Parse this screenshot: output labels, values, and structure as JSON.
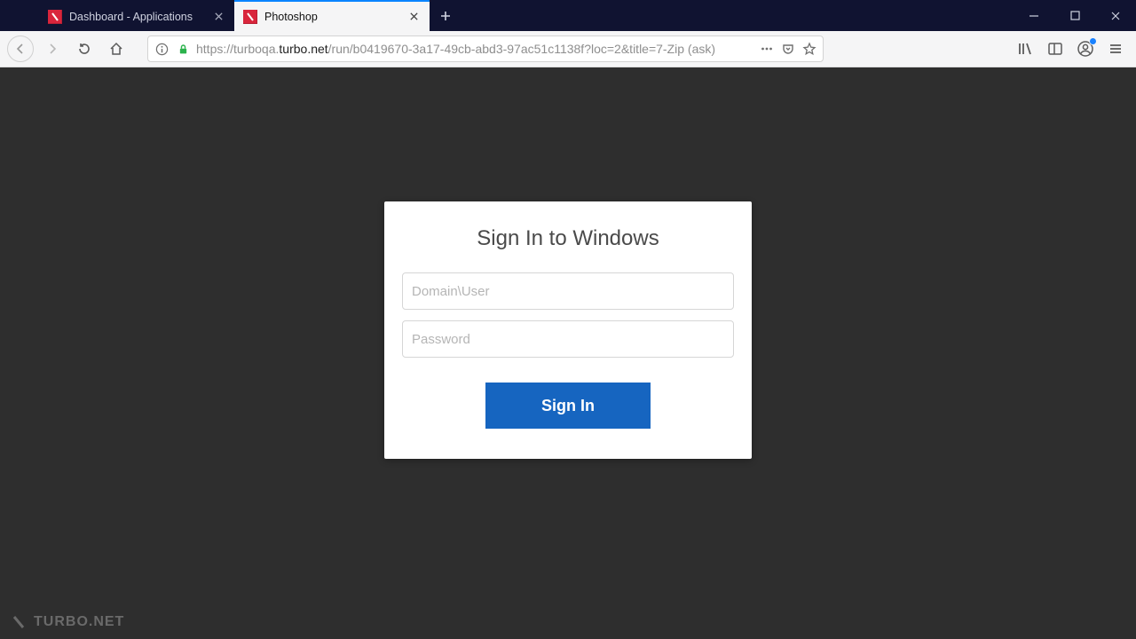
{
  "browser": {
    "tabs": [
      {
        "title": "Dashboard - Applications",
        "active": false
      },
      {
        "title": "Photoshop",
        "active": true
      }
    ],
    "url": {
      "prefix": "https://turboqa.",
      "host": "turbo.net",
      "path": "/run/b0419670-3a17-49cb-abd3-97ac51c1138f?loc=2&title=7-Zip (ask)"
    }
  },
  "login": {
    "heading": "Sign In to Windows",
    "username_placeholder": "Domain\\User",
    "password_placeholder": "Password",
    "username_value": "",
    "password_value": "",
    "submit_label": "Sign In"
  },
  "watermark": "TURBO.NET"
}
